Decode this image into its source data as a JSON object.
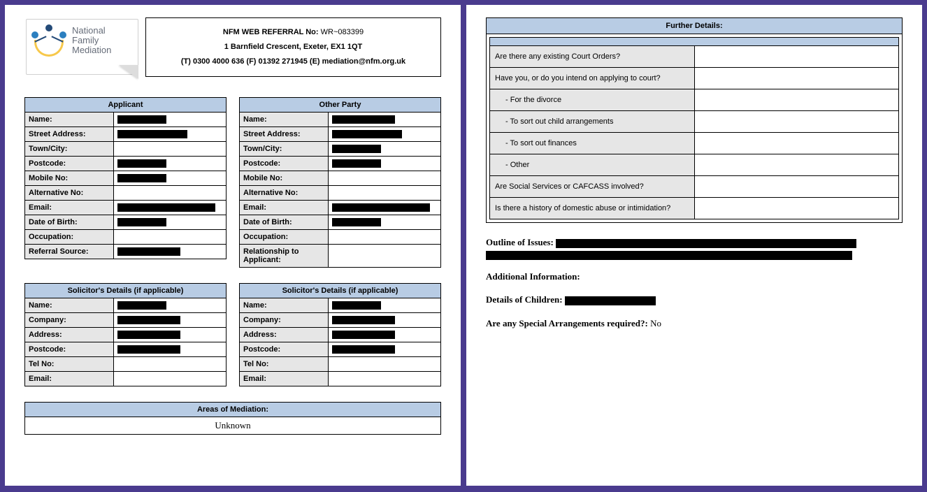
{
  "logo": {
    "line1": "National",
    "line2": "Family",
    "line3": "Mediation"
  },
  "header": {
    "ref_label": "NFM WEB REFERRAL No:",
    "ref_value": "WR~083399",
    "address": "1 Barnfield Crescent, Exeter, EX1 1QT",
    "contact": "(T) 0300 4000 636 (F) 01392 271945 (E) mediation@nfm.org.uk"
  },
  "applicant": {
    "title": "Applicant",
    "rows": [
      {
        "label": "Name:",
        "redact": "w40"
      },
      {
        "label": "Street Address:",
        "redact": "w60"
      },
      {
        "label": "Town/City:",
        "redact": ""
      },
      {
        "label": "Postcode:",
        "redact": "w40"
      },
      {
        "label": "Mobile No:",
        "redact": "w40"
      },
      {
        "label": "Alternative No:",
        "redact": ""
      },
      {
        "label": "Email:",
        "redact": "w80"
      },
      {
        "label": "Date of Birth:",
        "redact": "w40"
      },
      {
        "label": "Occupation:",
        "redact": ""
      },
      {
        "label": "Referral Source:",
        "redact": "w55"
      }
    ]
  },
  "other_party": {
    "title": "Other Party",
    "rows": [
      {
        "label": "Name:",
        "redact": "w55"
      },
      {
        "label": "Street Address:",
        "redact": "w60"
      },
      {
        "label": "Town/City:",
        "redact": "w40"
      },
      {
        "label": "Postcode:",
        "redact": "w40"
      },
      {
        "label": "Mobile No:",
        "redact": ""
      },
      {
        "label": "Alternative No:",
        "redact": ""
      },
      {
        "label": "Email:",
        "redact": "w80"
      },
      {
        "label": "Date of Birth:",
        "redact": "w40"
      },
      {
        "label": "Occupation:",
        "redact": ""
      },
      {
        "label": "Relationship to Applicant:",
        "redact": ""
      }
    ]
  },
  "solicitor": {
    "title": "Solicitor's Details (if applicable)",
    "rows": [
      {
        "label": "Name:",
        "redact": "w40"
      },
      {
        "label": "Company:",
        "redact": "w55"
      },
      {
        "label": "Address:",
        "redact": "w55"
      },
      {
        "label": "Postcode:",
        "redact": "w55"
      },
      {
        "label": "Tel No:",
        "redact": ""
      },
      {
        "label": "Email:",
        "redact": ""
      }
    ]
  },
  "areas": {
    "title": "Areas of Mediation:",
    "value": "Unknown"
  },
  "further": {
    "title": "Further Details:",
    "questions": [
      {
        "q": "Are there any existing Court Orders?",
        "indent": false
      },
      {
        "q": "Have you, or do you intend on applying to court?",
        "indent": false
      },
      {
        "q": "- For the divorce",
        "indent": true
      },
      {
        "q": "- To sort out child arrangements",
        "indent": true
      },
      {
        "q": "- To sort out finances",
        "indent": true
      },
      {
        "q": "- Other",
        "indent": true
      },
      {
        "q": "Are Social Services or CAFCASS involved?",
        "indent": false
      },
      {
        "q": "Is there a history of domestic abuse or intimidation?",
        "indent": false
      }
    ]
  },
  "outline_label": "Outline of Issues:",
  "additional_label": "Additional Information:",
  "children_label": "Details of Children:",
  "special_label": "Are any Special Arrangements required?:",
  "special_value": "No"
}
